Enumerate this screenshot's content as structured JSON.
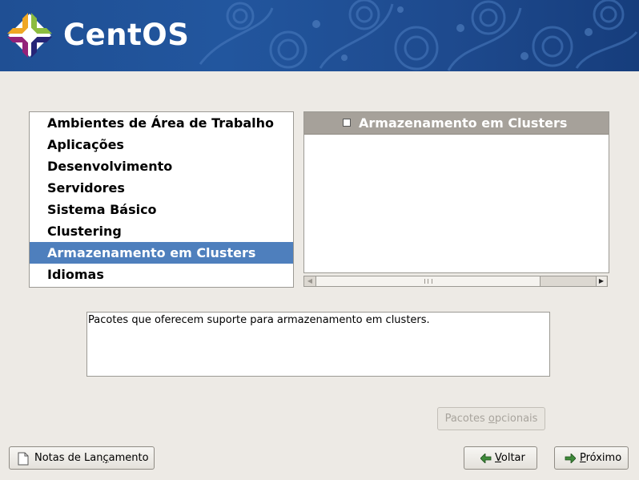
{
  "banner": {
    "brand": "CentOS",
    "colors": {
      "background": "#22569e",
      "logo_purple": "#932279",
      "logo_yellow": "#efa724",
      "logo_green": "#8cbc3f",
      "logo_blue": "#262577"
    }
  },
  "groups": {
    "selected_index": 6,
    "items": [
      {
        "label": "Ambientes de Área de Trabalho"
      },
      {
        "label": "Aplicações"
      },
      {
        "label": "Desenvolvimento"
      },
      {
        "label": "Servidores"
      },
      {
        "label": "Sistema Básico"
      },
      {
        "label": "Clustering"
      },
      {
        "label": "Armazenamento em Clusters"
      },
      {
        "label": "Idiomas"
      }
    ],
    "selection_color": "#4e7fbd"
  },
  "packages": {
    "header": {
      "label": "Armazenamento em Clusters",
      "checked": false
    }
  },
  "description": {
    "text": "Pacotes que oferecem suporte para armazenamento em clusters."
  },
  "buttons": {
    "optional": {
      "pre": "Pacotes ",
      "key": "o",
      "post": "pcionais",
      "enabled": false
    },
    "release_notes": {
      "pre": "Notas de Lan",
      "key": "ç",
      "post": "amento",
      "icon": "document-icon"
    },
    "back": {
      "pre": "",
      "key": "V",
      "post": "oltar",
      "icon": "arrow-left-icon"
    },
    "next": {
      "pre": "",
      "key": "P",
      "post": "róximo",
      "icon": "arrow-right-icon"
    }
  }
}
